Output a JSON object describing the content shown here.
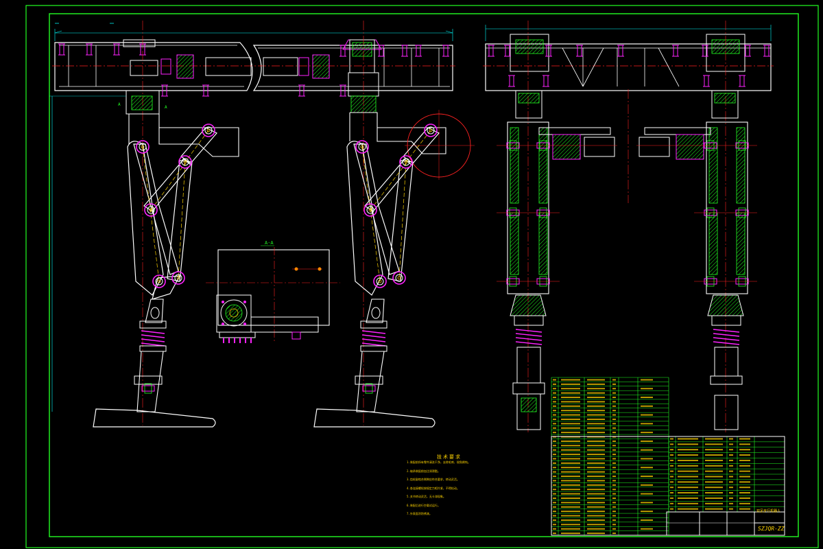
{
  "drawing": {
    "section_label": "A-A",
    "section_marker": "A",
    "tech_title": "技术要求",
    "tech_notes": [
      "1.装配前所有零件清洗干净，去除毛刺、锐角倒钝。",
      "2.轴承装配前加注润滑脂。",
      "3.齿轮副啮合侧隙应符合要求，转动灵活。",
      "4.各连接螺栓按规定力矩拧紧，不得松动。",
      "5.关节转动灵活，无卡滞现象。",
      "6.装配后进行空载试运行。",
      "7.外表面涂防锈漆。"
    ],
    "title_block": {
      "drawing_name": "双足步行机器人",
      "drawing_code": "SZJQR-ZZ"
    }
  },
  "colors": {
    "background": "#000000",
    "frame": "#22ff22",
    "outline": "#ffffff",
    "centerline": "#ff2222",
    "fastener": "#ff22ff",
    "hatch": "#22ff22",
    "dimension": "#00ffff",
    "text": "#ffd400"
  }
}
